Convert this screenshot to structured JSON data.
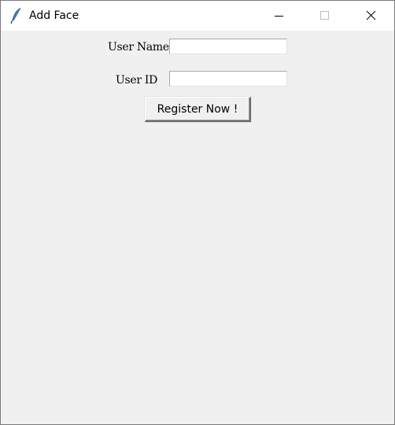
{
  "window": {
    "title": "Add Face",
    "app_icon": "feather-icon",
    "controls": {
      "minimize_icon": "minimize-icon",
      "maximize_icon": "maximize-icon",
      "close_icon": "close-icon"
    }
  },
  "form": {
    "username": {
      "label": "User Name",
      "value": ""
    },
    "userid": {
      "label": "User ID",
      "value": ""
    },
    "register_button": "Register Now !"
  },
  "colors": {
    "titlebar": "#ffffff",
    "background": "#f0f0f0",
    "entry_background": "#ffffff",
    "feather_icon": "#2b5fa8"
  }
}
